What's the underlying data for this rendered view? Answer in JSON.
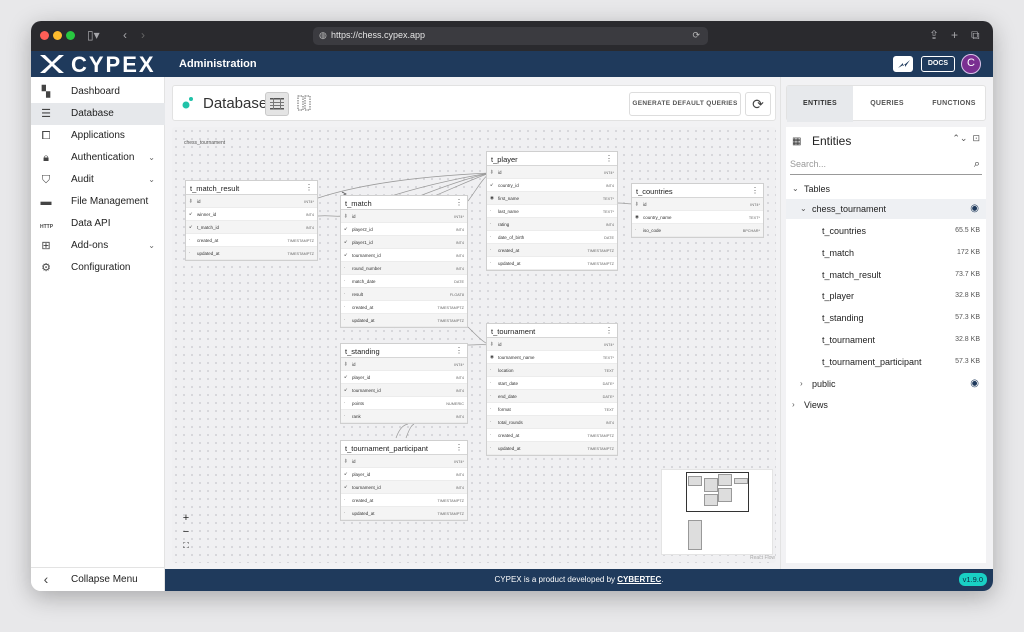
{
  "browser": {
    "url": "https://chess.cypex.app",
    "tab_icons": [
      "sidebar-icon",
      "back-icon",
      "forward-icon"
    ]
  },
  "app": {
    "logo": "CYPEX",
    "header_title": "Administration",
    "docs_label": "DOCS",
    "avatar_letter": "C"
  },
  "sidebar": {
    "items": [
      {
        "label": "Dashboard",
        "icon": "dashboard-icon"
      },
      {
        "label": "Database",
        "icon": "database-icon",
        "active": true
      },
      {
        "label": "Applications",
        "icon": "applications-icon"
      },
      {
        "label": "Authentication",
        "icon": "lock-icon",
        "chevron": true
      },
      {
        "label": "Audit",
        "icon": "shield-icon",
        "chevron": true
      },
      {
        "label": "File Management",
        "icon": "folder-icon"
      },
      {
        "label": "Data API",
        "icon": "http-icon",
        "icon_text": "HTTP"
      },
      {
        "label": "Add-ons",
        "icon": "add-box-icon",
        "chevron": true
      },
      {
        "label": "Configuration",
        "icon": "wrench-icon"
      }
    ],
    "collapse_label": "Collapse Menu"
  },
  "database": {
    "title": "Database",
    "generate_label": "GENERATE DEFAULT QUERIES",
    "schema_label": "chess_tournament",
    "react_flow_label": "React Flow",
    "tables": {
      "t_match_result": {
        "name": "t_match_result",
        "cols": [
          {
            "icon": "key",
            "name": "id",
            "type": "INT4*"
          },
          {
            "icon": "fk",
            "name": "winner_id",
            "type": "INT4"
          },
          {
            "icon": "fk",
            "name": "t_match_id",
            "type": "INT4"
          },
          {
            "icon": "",
            "name": "created_at",
            "type": "TIMESTAMPTZ"
          },
          {
            "icon": "",
            "name": "updated_at",
            "type": "TIMESTAMPTZ"
          }
        ]
      },
      "t_match": {
        "name": "t_match",
        "cols": [
          {
            "icon": "key",
            "name": "id",
            "type": "INT4*"
          },
          {
            "icon": "fk",
            "name": "player2_id",
            "type": "INT4"
          },
          {
            "icon": "fk",
            "name": "player1_id",
            "type": "INT4"
          },
          {
            "icon": "fk",
            "name": "tournament_id",
            "type": "INT4"
          },
          {
            "icon": "",
            "name": "round_number",
            "type": "INT4"
          },
          {
            "icon": "",
            "name": "match_date",
            "type": "DATE"
          },
          {
            "icon": "",
            "name": "result",
            "type": "FLOAT8"
          },
          {
            "icon": "",
            "name": "created_at",
            "type": "TIMESTAMPTZ"
          },
          {
            "icon": "",
            "name": "updated_at",
            "type": "TIMESTAMPTZ"
          }
        ]
      },
      "t_player": {
        "name": "t_player",
        "cols": [
          {
            "icon": "key",
            "name": "id",
            "type": "INT4*"
          },
          {
            "icon": "fk",
            "name": "country_id",
            "type": "INT4"
          },
          {
            "icon": "eye",
            "name": "first_name",
            "type": "TEXT*"
          },
          {
            "icon": "",
            "name": "last_name",
            "type": "TEXT*"
          },
          {
            "icon": "",
            "name": "rating",
            "type": "INT4"
          },
          {
            "icon": "",
            "name": "date_of_birth",
            "type": "DATE"
          },
          {
            "icon": "",
            "name": "created_at",
            "type": "TIMESTAMPTZ"
          },
          {
            "icon": "",
            "name": "updated_at",
            "type": "TIMESTAMPTZ"
          }
        ]
      },
      "t_countries": {
        "name": "t_countries",
        "cols": [
          {
            "icon": "key",
            "name": "id",
            "type": "INT4*"
          },
          {
            "icon": "eye",
            "name": "country_name",
            "type": "TEXT*"
          },
          {
            "icon": "",
            "name": "iso_code",
            "type": "BPCHAR*"
          }
        ]
      },
      "t_tournament": {
        "name": "t_tournament",
        "cols": [
          {
            "icon": "key",
            "name": "id",
            "type": "INT4*"
          },
          {
            "icon": "eye",
            "name": "tournament_name",
            "type": "TEXT*"
          },
          {
            "icon": "",
            "name": "location",
            "type": "TEXT"
          },
          {
            "icon": "",
            "name": "start_date",
            "type": "DATE*"
          },
          {
            "icon": "",
            "name": "end_date",
            "type": "DATE*"
          },
          {
            "icon": "",
            "name": "format",
            "type": "TEXT"
          },
          {
            "icon": "",
            "name": "total_rounds",
            "type": "INT4"
          },
          {
            "icon": "",
            "name": "created_at",
            "type": "TIMESTAMPTZ"
          },
          {
            "icon": "",
            "name": "updated_at",
            "type": "TIMESTAMPTZ"
          }
        ]
      },
      "t_standing": {
        "name": "t_standing",
        "cols": [
          {
            "icon": "key",
            "name": "id",
            "type": "INT4*"
          },
          {
            "icon": "fk",
            "name": "player_id",
            "type": "INT4"
          },
          {
            "icon": "fk",
            "name": "tournament_id",
            "type": "INT4"
          },
          {
            "icon": "",
            "name": "points",
            "type": "NUMERIC"
          },
          {
            "icon": "",
            "name": "rank",
            "type": "INT4"
          }
        ]
      },
      "t_tournament_participant": {
        "name": "t_tournament_participant",
        "cols": [
          {
            "icon": "key",
            "name": "id",
            "type": "INT4*"
          },
          {
            "icon": "fk",
            "name": "player_id",
            "type": "INT4"
          },
          {
            "icon": "fk",
            "name": "tournament_id",
            "type": "INT4"
          },
          {
            "icon": "",
            "name": "created_at",
            "type": "TIMESTAMPTZ"
          },
          {
            "icon": "",
            "name": "updated_at",
            "type": "TIMESTAMPTZ"
          }
        ]
      }
    }
  },
  "right_panel": {
    "tabs": [
      "ENTITIES",
      "QUERIES",
      "FUNCTIONS"
    ],
    "entities_title": "Entities",
    "search_placeholder": "Search...",
    "tables_label": "Tables",
    "schema_name": "chess_tournament",
    "table_list": [
      {
        "name": "t_countries",
        "size": "65.5 KB"
      },
      {
        "name": "t_match",
        "size": "172 KB"
      },
      {
        "name": "t_match_result",
        "size": "73.7 KB"
      },
      {
        "name": "t_player",
        "size": "32.8 KB"
      },
      {
        "name": "t_standing",
        "size": "57.3 KB"
      },
      {
        "name": "t_tournament",
        "size": "32.8 KB"
      },
      {
        "name": "t_tournament_participant",
        "size": "57.3 KB"
      }
    ],
    "public_label": "public",
    "views_label": "Views"
  },
  "footer": {
    "text_prefix": "CYPEX is a product developed by ",
    "company": "CYBERTEC",
    "text_suffix": ".",
    "version": "v1.9.0"
  },
  "colors": {
    "header": "#1f3a5c",
    "accent": "#19d0c4",
    "avatar": "#7a2f91"
  }
}
